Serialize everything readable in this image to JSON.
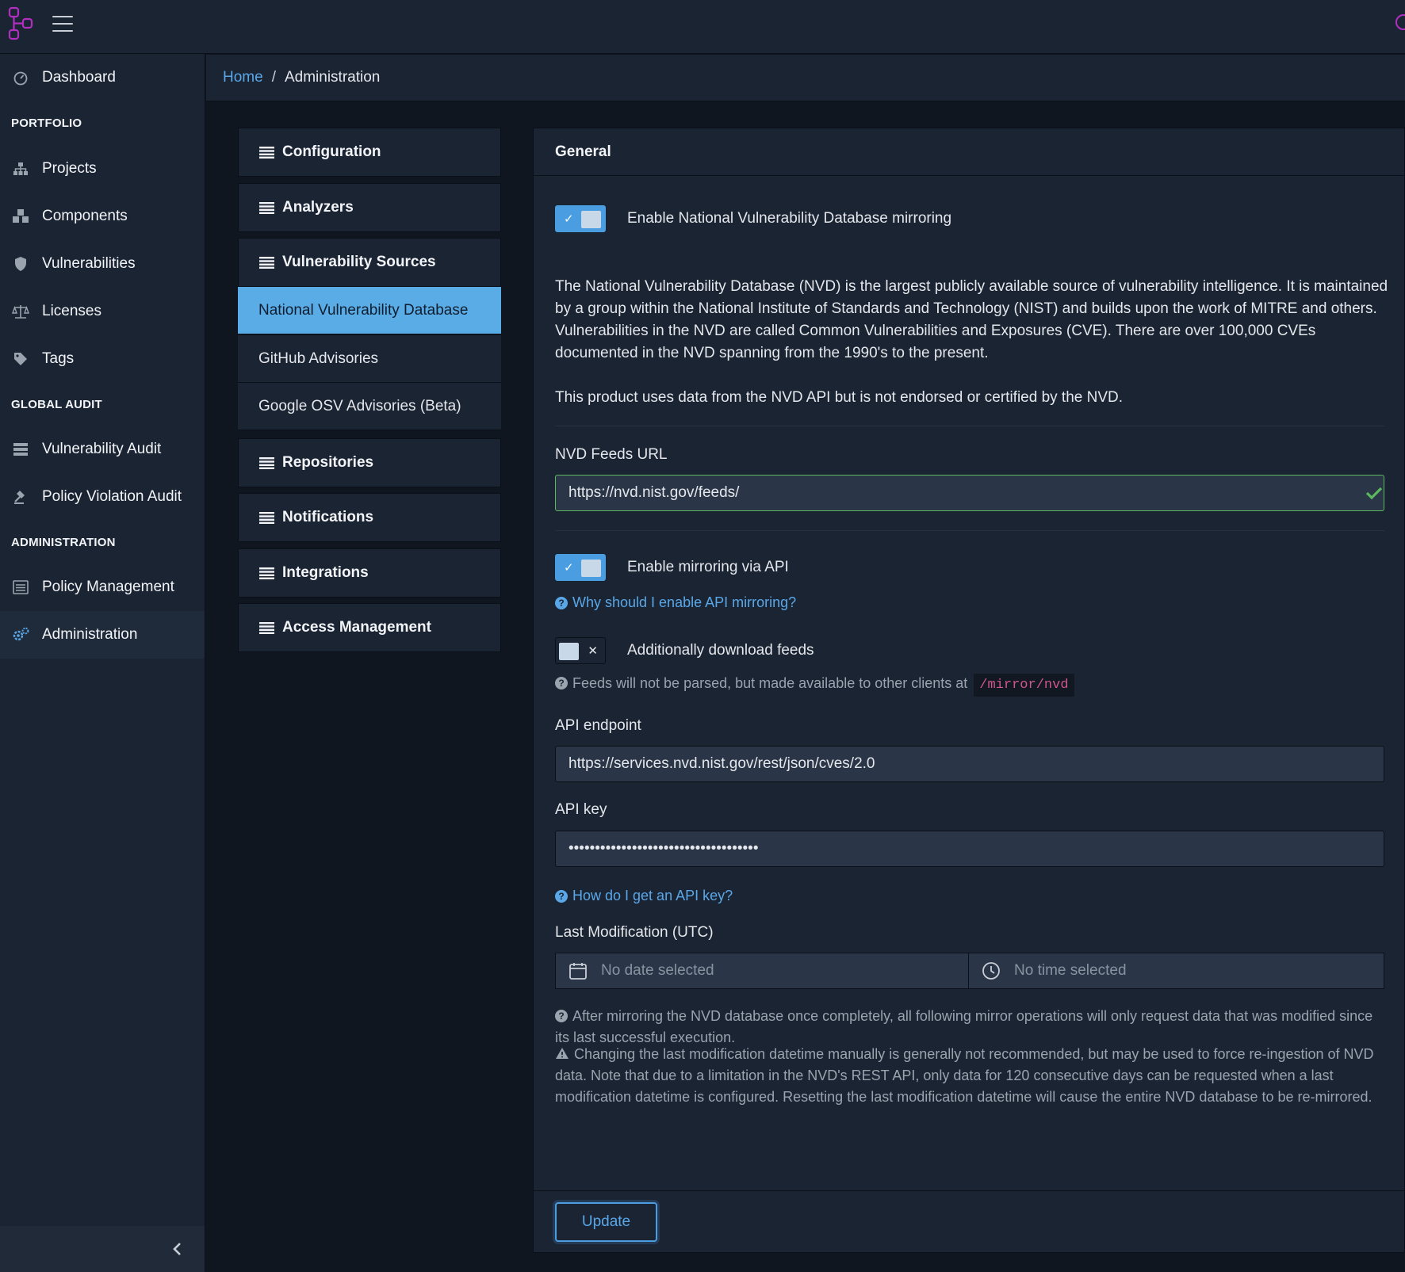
{
  "sidebar": {
    "dashboard": "Dashboard",
    "section_portfolio": "PORTFOLIO",
    "projects": "Projects",
    "components": "Components",
    "vulnerabilities": "Vulnerabilities",
    "licenses": "Licenses",
    "tags": "Tags",
    "section_global_audit": "GLOBAL AUDIT",
    "vulnerability_audit": "Vulnerability Audit",
    "policy_violation_audit": "Policy Violation Audit",
    "section_administration": "ADMINISTRATION",
    "policy_management": "Policy Management",
    "administration": "Administration"
  },
  "breadcrumb": {
    "home": "Home",
    "separator": "/",
    "current": "Administration"
  },
  "admin_menu": {
    "configuration": "Configuration",
    "analyzers": "Analyzers",
    "vulnerability_sources": "Vulnerability Sources",
    "sub_nvd": "National Vulnerability Database",
    "sub_github": "GitHub Advisories",
    "sub_osv": "Google OSV Advisories (Beta)",
    "repositories": "Repositories",
    "notifications": "Notifications",
    "integrations": "Integrations",
    "access_management": "Access Management"
  },
  "panel": {
    "title": "General",
    "enable_mirroring_label": "Enable National Vulnerability Database mirroring",
    "enable_mirroring_on": true,
    "description": "The National Vulnerability Database (NVD) is the largest publicly available source of vulnerability intelligence. It is maintained by a group within the National Institute of Standards and Technology (NIST) and builds upon the work of MITRE and others. Vulnerabilities in the NVD are called Common Vulnerabilities and Exposures (CVE). There are over 100,000 CVEs documented in the NVD spanning from the 1990's to the present.",
    "disclaimer": "This product uses data from the NVD API but is not endorsed or certified by the NVD.",
    "feeds_url_label": "NVD Feeds URL",
    "feeds_url_value": "https://nvd.nist.gov/feeds/",
    "enable_api_label": "Enable mirroring via API",
    "enable_api_on": true,
    "why_api_link": "Why should I enable API mirroring?",
    "download_feeds_label": "Additionally download feeds",
    "download_feeds_on": false,
    "feeds_help": "Feeds will not be parsed, but made available to other clients at",
    "feeds_path": "/mirror/nvd",
    "api_endpoint_label": "API endpoint",
    "api_endpoint_value": "https://services.nvd.nist.gov/rest/json/cves/2.0",
    "api_key_label": "API key",
    "api_key_value": "••••••••••••••••••••••••••••••••••••",
    "api_key_link": "How do I get an API key?",
    "last_mod_label": "Last Modification (UTC)",
    "date_placeholder": "No date selected",
    "time_placeholder": "No time selected",
    "last_mod_help": "After mirroring the NVD database once completely, all following mirror operations will only request data that was modified since its last successful execution.",
    "last_mod_warning": "Changing the last modification datetime manually is generally not recommended, but may be used to force re-ingestion of NVD data. Note that due to a limitation in the NVD's REST API, only data for 120 consecutive days can be requested when a last modification datetime is configured. Resetting the last modification datetime will cause the entire NVD database to be re-mirrored.",
    "update_button": "Update"
  },
  "colors": {
    "accent": "#5aa7e8",
    "active_menu": "#5aace6",
    "toggle_on": "#4a9de0",
    "valid": "#5cb85c",
    "logo": "#b02fc0",
    "code": "#d0568c"
  }
}
